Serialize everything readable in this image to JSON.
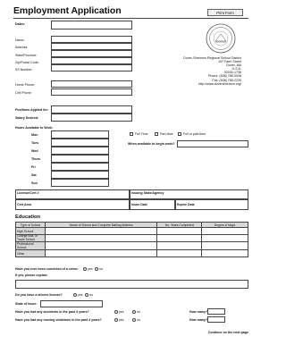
{
  "header": {
    "title": "Employment Application",
    "print_label": "Print Form"
  },
  "labels": {
    "dates": "Dates:",
    "name": "Name:",
    "address": "Address:",
    "state": "State/Province:",
    "zip": "Zip/Postal Code:",
    "ss": "SS Number:",
    "home_phone": "Home Phone:",
    "cell_phone": "Cell Phone:",
    "positions": "Positions Applied for:",
    "salary": "Salary Desired:",
    "hours": "Hours Available to Work:",
    "begin_work": "When available to begin work?",
    "license": "License/Cert #",
    "issuing": "Issuing State/Agency",
    "cert_area": "Cert Area",
    "issue_date": "Issue Date",
    "expire_date": "Expire Date",
    "convicted": "Have you ever been convicted of a crime:",
    "if_yes": "If yes, please explain",
    "drivers_license": "Do you have a drivers license?",
    "state_issue": "State of Issue:",
    "accidents": "Have you had any accidents in the past 3 years?",
    "violations": "Have you had any moving violations in the past 3 years?",
    "how_many": "How many?",
    "yes": "yes",
    "no": "no",
    "continue": "Continue on the next page"
  },
  "days": [
    "Mon",
    "Tues",
    "Wed",
    "Thurs",
    "Fri",
    "Sat",
    "Sun"
  ],
  "schedule_options": [
    "Full Time",
    "Part-time",
    "Full or part-time"
  ],
  "school": {
    "name": "Dover-Sherborn Regional School District",
    "address_lines": [
      "157 Farm Street",
      "Dover, MA",
      "U.S.A.",
      "02030-1736"
    ],
    "phone": "Phone: (508) 785-0036",
    "fax": "Fax: (508) 785-2239",
    "web": "http://www.doversherborn.org/"
  },
  "education": {
    "heading": "Education",
    "columns": [
      "Type of School",
      "Name of School and Complete Mailing Address",
      "No. Years Completed",
      "Degree & Major"
    ],
    "rows": [
      "High School",
      "College Bus. or Trade School",
      "Professional School",
      "Other"
    ]
  }
}
